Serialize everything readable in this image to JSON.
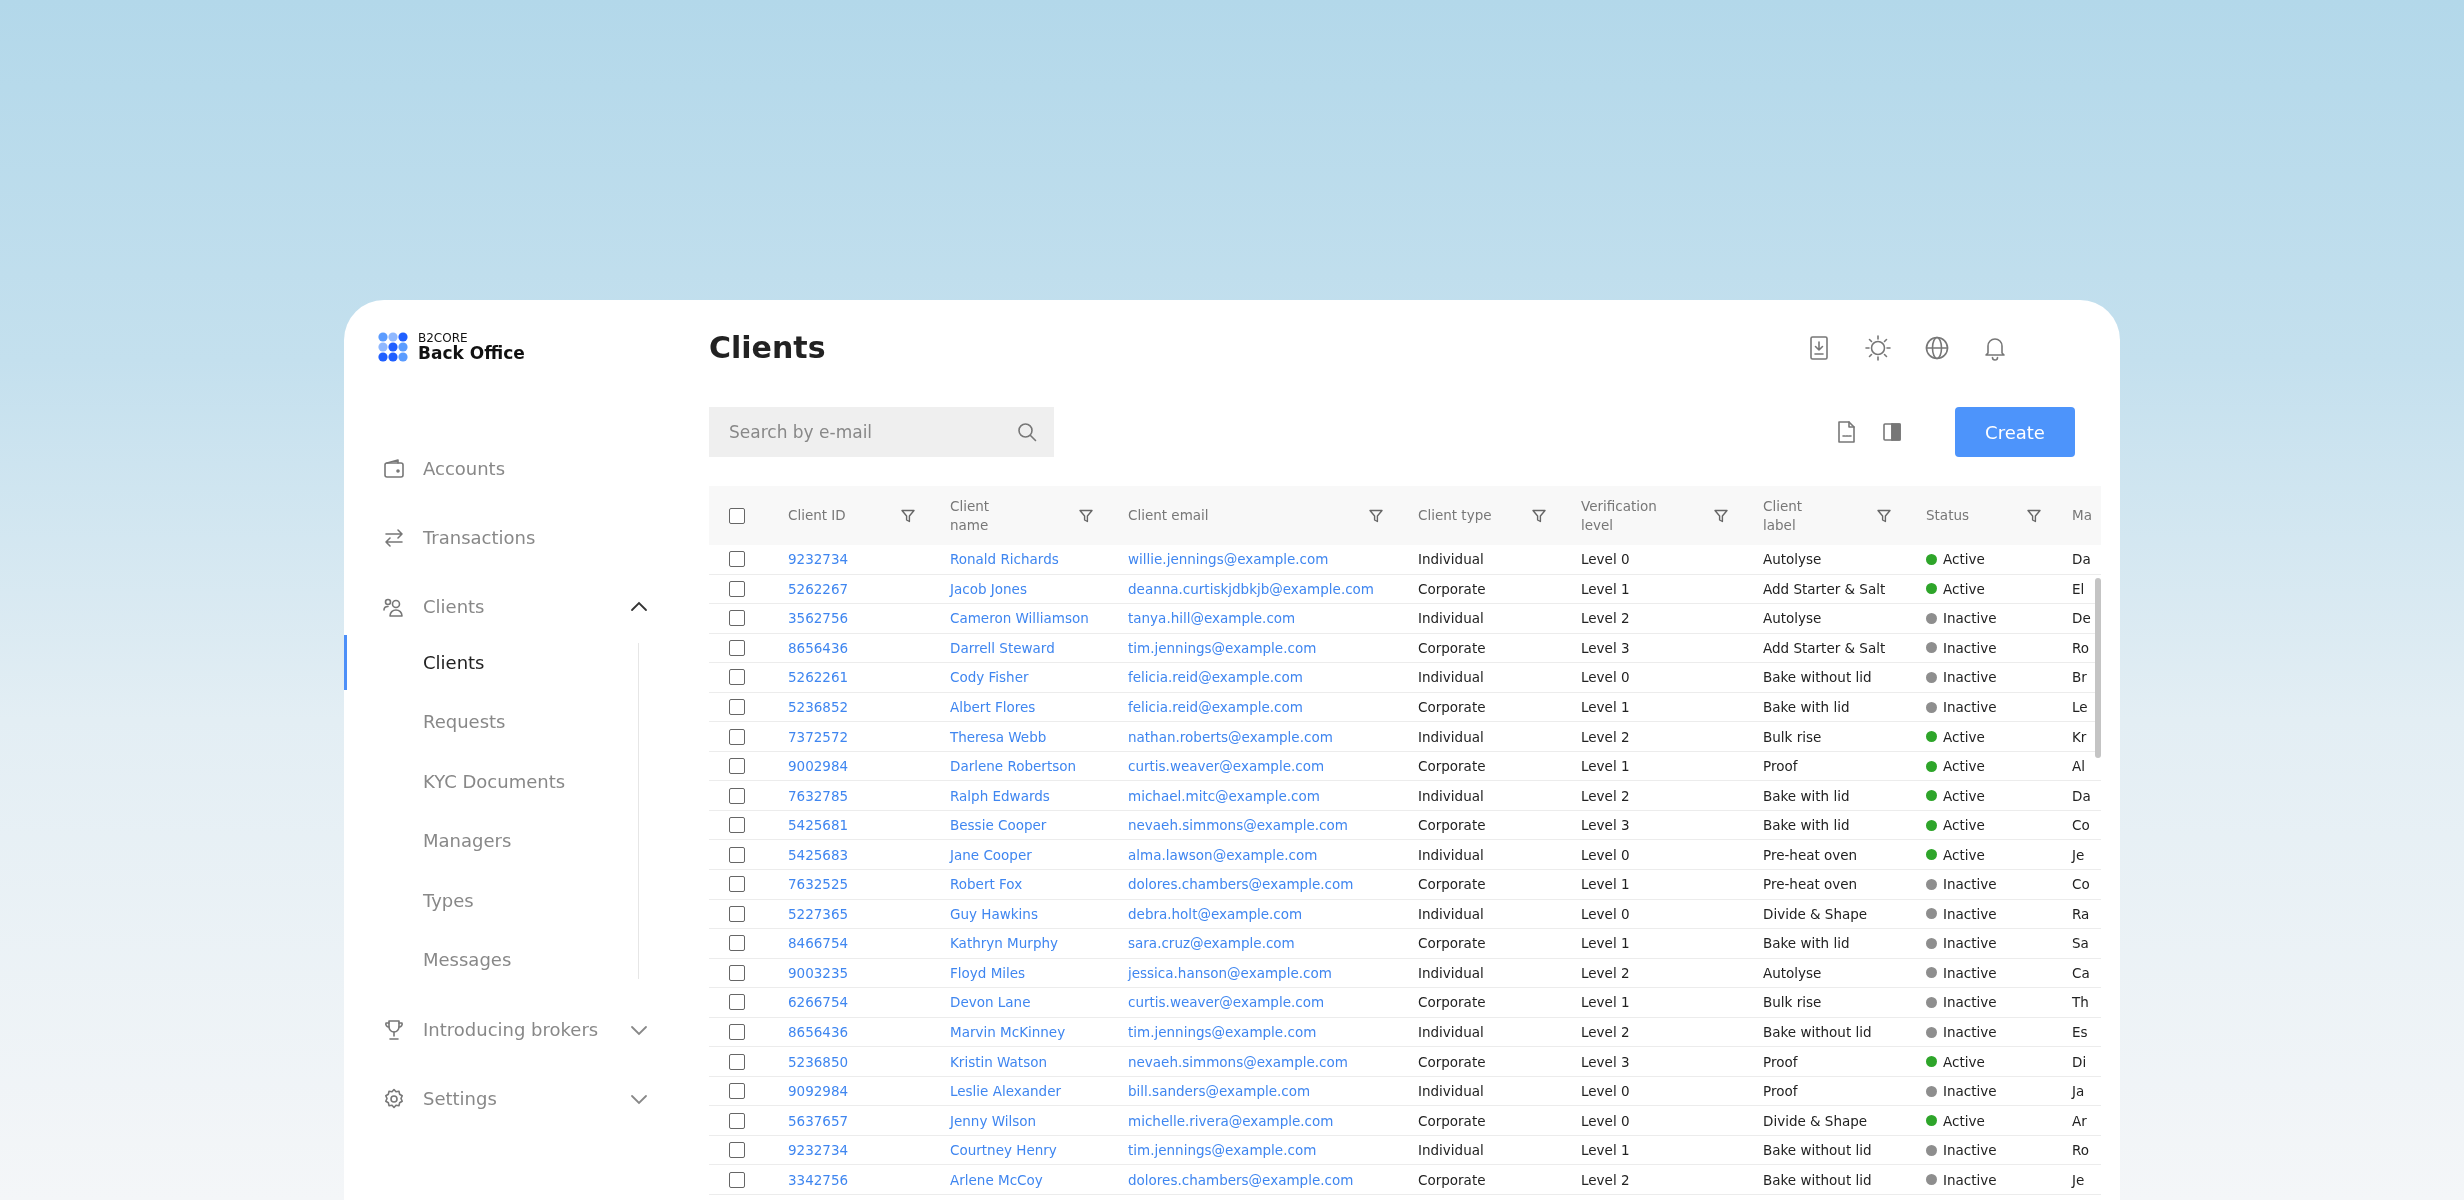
{
  "logo": {
    "brand": "B2CORE",
    "product": "Back Office"
  },
  "sidebar": {
    "items": [
      {
        "label": "Accounts"
      },
      {
        "label": "Transactions"
      },
      {
        "label": "Clients",
        "expanded": true,
        "children": [
          {
            "label": "Clients",
            "selected": true
          },
          {
            "label": "Requests",
            "selected": false
          },
          {
            "label": "KYC Documents",
            "selected": false
          },
          {
            "label": "Managers",
            "selected": false
          },
          {
            "label": "Types",
            "selected": false
          },
          {
            "label": "Messages",
            "selected": false
          }
        ]
      },
      {
        "label": "Introducing brokers",
        "expanded": false
      },
      {
        "label": "Settings",
        "expanded": false
      }
    ]
  },
  "page": {
    "title": "Clients"
  },
  "search": {
    "placeholder": "Search by e-mail"
  },
  "create_button": "Create",
  "table": {
    "select_all_checked": false,
    "columns": [
      {
        "label": "Client ID",
        "filter": true
      },
      {
        "label": "Client\nname",
        "filter": true
      },
      {
        "label": "Client email",
        "filter": true
      },
      {
        "label": "Client type",
        "filter": true
      },
      {
        "label": "Verification\nlevel",
        "filter": true
      },
      {
        "label": "Client\nlabel",
        "filter": true
      },
      {
        "label": "Status",
        "filter": true
      },
      {
        "label": "Ma",
        "filter": false
      }
    ],
    "rows": [
      {
        "checked": false,
        "id": "9232734",
        "name": "Ronald Richards",
        "email": "willie.jennings@example.com",
        "type": "Individual",
        "level": "Level 0",
        "label": "Autolyse",
        "status": {
          "text": "Active",
          "color": "#2ea52a"
        },
        "column_9": "Da"
      },
      {
        "checked": false,
        "id": "5262267",
        "name": "Jacob Jones",
        "email": "deanna.curtiskjdbkjb@example.com",
        "type": "Corporate",
        "level": "Level 1",
        "label": "Add Starter & Salt",
        "status": {
          "text": "Active",
          "color": "#2ea52a"
        },
        "column_9": "El"
      },
      {
        "checked": false,
        "id": "3562756",
        "name": "Cameron Williamson",
        "email": "tanya.hill@example.com",
        "type": "Individual",
        "level": "Level 2",
        "label": "Autolyse",
        "status": {
          "text": "Inactive",
          "color": "#8e8e8e"
        },
        "column_9": "De"
      },
      {
        "checked": false,
        "id": "8656436",
        "name": "Darrell Steward",
        "email": "tim.jennings@example.com",
        "type": "Corporate",
        "level": "Level 3",
        "label": "Add Starter & Salt",
        "status": {
          "text": "Inactive",
          "color": "#8e8e8e"
        },
        "column_9": "Ro"
      },
      {
        "checked": false,
        "id": "5262261",
        "name": "Cody Fisher",
        "email": "felicia.reid@example.com",
        "type": "Individual",
        "level": "Level 0",
        "label": "Bake without lid",
        "status": {
          "text": "Inactive",
          "color": "#8e8e8e"
        },
        "column_9": "Br"
      },
      {
        "checked": false,
        "id": "5236852",
        "name": "Albert Flores",
        "email": "felicia.reid@example.com",
        "type": "Corporate",
        "level": "Level 1",
        "label": "Bake with lid",
        "status": {
          "text": "Inactive",
          "color": "#8e8e8e"
        },
        "column_9": "Le"
      },
      {
        "checked": false,
        "id": "7372572",
        "name": "Theresa Webb",
        "email": "nathan.roberts@example.com",
        "type": "Individual",
        "level": "Level 2",
        "label": "Bulk rise",
        "status": {
          "text": "Active",
          "color": "#2ea52a"
        },
        "column_9": "Kr"
      },
      {
        "checked": false,
        "id": "9002984",
        "name": "Darlene Robertson",
        "email": "curtis.weaver@example.com",
        "type": "Corporate",
        "level": "Level 1",
        "label": "Proof",
        "status": {
          "text": "Active",
          "color": "#2ea52a"
        },
        "column_9": "Al"
      },
      {
        "checked": false,
        "id": "7632785",
        "name": "Ralph Edwards",
        "email": "michael.mitc@example.com",
        "type": "Individual",
        "level": "Level 2",
        "label": "Bake with lid",
        "status": {
          "text": "Active",
          "color": "#2ea52a"
        },
        "column_9": "Da"
      },
      {
        "checked": false,
        "id": "5425681",
        "name": "Bessie Cooper",
        "email": "nevaeh.simmons@example.com",
        "type": "Corporate",
        "level": "Level 3",
        "label": "Bake with lid",
        "status": {
          "text": "Active",
          "color": "#2ea52a"
        },
        "column_9": "Co"
      },
      {
        "checked": false,
        "id": "5425683",
        "name": "Jane Cooper",
        "email": "alma.lawson@example.com",
        "type": "Individual",
        "level": "Level 0",
        "label": "Pre-heat oven",
        "status": {
          "text": "Active",
          "color": "#2ea52a"
        },
        "column_9": "Je"
      },
      {
        "checked": false,
        "id": "7632525",
        "name": "Robert Fox",
        "email": "dolores.chambers@example.com",
        "type": "Corporate",
        "level": "Level 1",
        "label": "Pre-heat oven",
        "status": {
          "text": "Inactive",
          "color": "#8e8e8e"
        },
        "column_9": "Co"
      },
      {
        "checked": false,
        "id": "5227365",
        "name": "Guy Hawkins",
        "email": "debra.holt@example.com",
        "type": "Individual",
        "level": "Level 0",
        "label": "Divide & Shape",
        "status": {
          "text": "Inactive",
          "color": "#8e8e8e"
        },
        "column_9": "Ra"
      },
      {
        "checked": false,
        "id": "8466754",
        "name": "Kathryn Murphy",
        "email": "sara.cruz@example.com",
        "type": "Corporate",
        "level": "Level 1",
        "label": "Bake with lid",
        "status": {
          "text": "Inactive",
          "color": "#8e8e8e"
        },
        "column_9": "Sa"
      },
      {
        "checked": false,
        "id": "9003235",
        "name": "Floyd Miles",
        "email": "jessica.hanson@example.com",
        "type": "Individual",
        "level": "Level 2",
        "label": "Autolyse",
        "status": {
          "text": "Inactive",
          "color": "#8e8e8e"
        },
        "column_9": "Ca"
      },
      {
        "checked": false,
        "id": "6266754",
        "name": "Devon Lane",
        "email": "curtis.weaver@example.com",
        "type": "Corporate",
        "level": "Level 1",
        "label": "Bulk rise",
        "status": {
          "text": "Inactive",
          "color": "#8e8e8e"
        },
        "column_9": "Th"
      },
      {
        "checked": false,
        "id": "8656436",
        "name": "Marvin McKinney",
        "email": "tim.jennings@example.com",
        "type": "Individual",
        "level": "Level 2",
        "label": "Bake without lid",
        "status": {
          "text": "Inactive",
          "color": "#8e8e8e"
        },
        "column_9": "Es"
      },
      {
        "checked": false,
        "id": "5236850",
        "name": "Kristin Watson",
        "email": "nevaeh.simmons@example.com",
        "type": "Corporate",
        "level": "Level 3",
        "label": "Proof",
        "status": {
          "text": "Active",
          "color": "#2ea52a"
        },
        "column_9": "Di"
      },
      {
        "checked": false,
        "id": "9092984",
        "name": "Leslie Alexander",
        "email": "bill.sanders@example.com",
        "type": "Individual",
        "level": "Level 0",
        "label": "Proof",
        "status": {
          "text": "Inactive",
          "color": "#8e8e8e"
        },
        "column_9": "Ja"
      },
      {
        "checked": false,
        "id": "5637657",
        "name": "Jenny Wilson",
        "email": "michelle.rivera@example.com",
        "type": "Corporate",
        "level": "Level 0",
        "label": "Divide & Shape",
        "status": {
          "text": "Active",
          "color": "#2ea52a"
        },
        "column_9": "Ar"
      },
      {
        "checked": false,
        "id": "9232734",
        "name": "Courtney Henry",
        "email": "tim.jennings@example.com",
        "type": "Individual",
        "level": "Level 1",
        "label": "Bake without lid",
        "status": {
          "text": "Inactive",
          "color": "#8e8e8e"
        },
        "column_9": "Ro"
      },
      {
        "checked": false,
        "id": "3342756",
        "name": "Arlene McCoy",
        "email": "dolores.chambers@example.com",
        "type": "Corporate",
        "level": "Level 2",
        "label": "Bake without lid",
        "status": {
          "text": "Inactive",
          "color": "#8e8e8e"
        },
        "column_9": "Je"
      }
    ]
  }
}
